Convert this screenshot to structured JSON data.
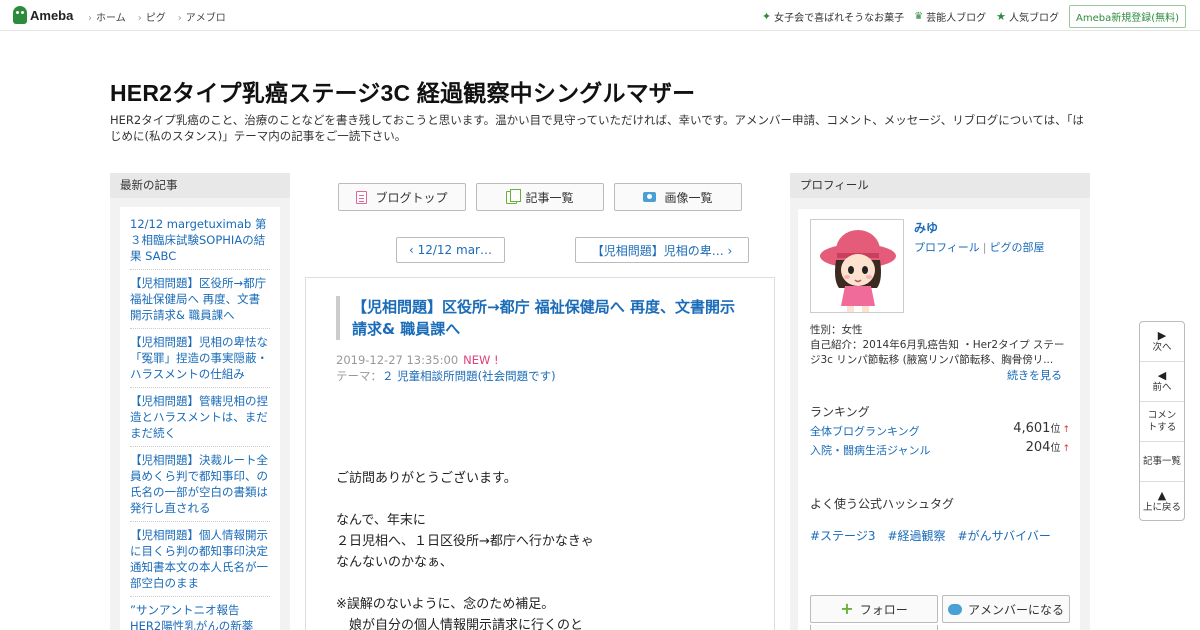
{
  "topbar": {
    "logo": "Ameba",
    "nav": [
      "ホーム",
      "ピグ",
      "アメブロ"
    ],
    "links": [
      {
        "icon": "star-icon",
        "label": "女子会で喜ばれそうなお菓子"
      },
      {
        "icon": "crown-icon",
        "label": "芸能人ブログ"
      },
      {
        "icon": "star-icon",
        "label": "人気ブログ"
      }
    ],
    "register": "Ameba新規登録(無料)"
  },
  "header": {
    "title": "HER2タイプ乳癌ステージ3C 経過観察中シングルマザー",
    "description": "HER2タイプ乳癌のこと、治療のことなどを書き残しておこうと思います。温かい目で見守っていただければ、幸いです。アメンバー申請、コメント、メッセージ、リブログについては、「はじめに(私のスタンス)」テーマ内の記事をご一読下さい。"
  },
  "left_sidebar": {
    "heading": "最新の記事",
    "items": [
      "12/12 margetuximab 第３相臨床試験SOPHIAの結果 SABC",
      "【児相問題】区役所→都庁 福祉保健局へ 再度、文書開示請求& 職員課へ",
      "【児相問題】児相の卑怯な「冤罪」捏造の事実隠蔽・ハラスメントの仕組み",
      "【児相問題】管轄児相の捏造とハラスメントは、まだまだ続く",
      "【児相問題】決裁ルート全員めくら判で都知事印、の氏名の一部が空白の書類は発行し直される",
      "【児相問題】個人情報開示に目くら判の都知事印決定通知書本文の本人氏名が一部空白のまま",
      "”サンアントニオ報告 HER2陽性乳がんの新薬"
    ]
  },
  "center": {
    "buttons": [
      {
        "icon": "blog-top-icon",
        "label": "ブログトップ"
      },
      {
        "icon": "article-list-icon",
        "label": "記事一覧"
      },
      {
        "icon": "camera-icon",
        "label": "画像一覧"
      }
    ],
    "prev": "‹ 12/12 mar…",
    "next": "【児相問題】児相の卑… ›",
    "article": {
      "title": "【児相問題】区役所→都庁 福祉保健局へ 再度、文書開示請求& 職員課へ",
      "date": "2019-12-27 13:35:00",
      "new_badge": "NEW !",
      "theme_label": "テーマ：",
      "theme": "２ 児童相談所問題(社会問題です)",
      "body": [
        "ご訪問ありがとうございます。",
        "",
        "なんで、年末に",
        "２日児相へ、１日区役所→都庁へ行かなきゃ",
        "なんないのかなぁ、",
        "",
        "※誤解のないように、念のため補足。",
        "　娘が自分の個人情報開示請求に行くのと"
      ]
    }
  },
  "right_sidebar": {
    "heading": "プロフィール",
    "name": "みゆ",
    "link_profile": "プロフィール",
    "link_room": "ピグの部屋",
    "gender": "性別：女性",
    "intro": "自己紹介：2014年6月乳癌告知 ・Her2タイプ ステージ3c リンパ節転移 (腋窩リンパ節転移、胸骨傍リ...",
    "more": "続きを見る",
    "ranking_heading": "ランキング",
    "rankings": [
      {
        "label": "全体ブログランキング",
        "value": "4,601",
        "unit": "位",
        "trend": "↑"
      },
      {
        "label": "入院・闘病生活ジャンル",
        "value": "204",
        "unit": "位",
        "trend": "↑"
      }
    ],
    "hashtag_heading": "よく使う公式ハッシュタグ",
    "hashtags": [
      "#ステージ3",
      "#経過観察",
      "#がんサバイバー"
    ],
    "follow": "フォロー",
    "amember": "アメンバーになる"
  },
  "float_nav": [
    {
      "icon": "play-right-icon",
      "label": "次へ"
    },
    {
      "icon": "play-left-icon",
      "label": "前へ"
    },
    {
      "icon": "",
      "label": "コメントする"
    },
    {
      "icon": "",
      "label": "記事一覧"
    },
    {
      "icon": "play-up-icon",
      "label": "上に戻る"
    }
  ]
}
